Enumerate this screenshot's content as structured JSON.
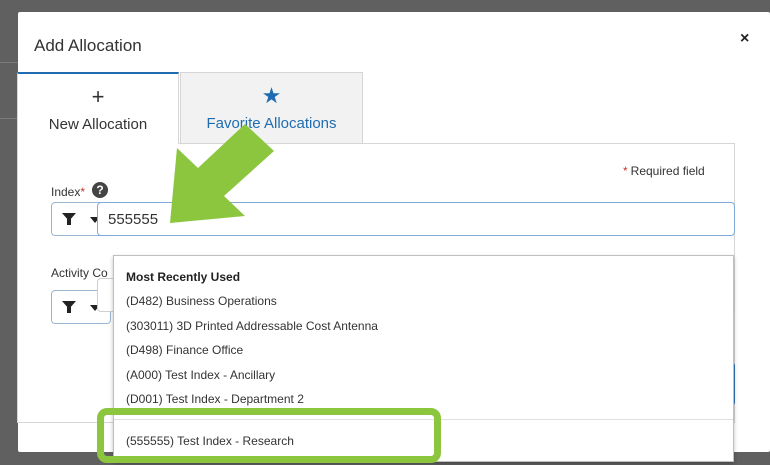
{
  "modal": {
    "title": "Add Allocation",
    "close_label": "×"
  },
  "tabs": [
    {
      "icon": "plus-icon",
      "glyph": "+",
      "label": "New Allocation",
      "active": true
    },
    {
      "icon": "star-icon",
      "glyph": "★",
      "label": "Favorite Allocations",
      "active": false
    }
  ],
  "form": {
    "required_note": "Required field",
    "required_marker": "*",
    "index": {
      "label": "Index",
      "value": "555555",
      "help_glyph": "?"
    },
    "activity": {
      "label": "Activity Co"
    }
  },
  "dropdown": {
    "heading": "Most Recently Used",
    "items": [
      "(D482) Business Operations",
      "(303011) 3D Printed Addressable Cost Antenna",
      "(D498) Finance Office",
      "(A000) Test Index - Ancillary",
      "(D001) Test Index - Department 2"
    ],
    "result": "(555555) Test Index - Research"
  },
  "colors": {
    "accent": "#1f6db0",
    "annotation": "#8cc63f",
    "required": "#c0392b"
  }
}
